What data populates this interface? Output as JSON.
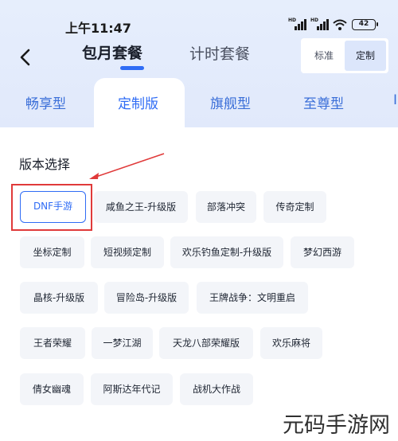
{
  "status_bar": {
    "time": "上午11:47",
    "battery": "42"
  },
  "header": {
    "tabs": [
      {
        "label": "包月套餐",
        "active": true
      },
      {
        "label": "计时套餐",
        "active": false
      }
    ],
    "segmented": [
      {
        "label": "标准",
        "active": false
      },
      {
        "label": "定制",
        "active": true
      }
    ]
  },
  "tiers": [
    {
      "label": "畅享型",
      "active": false
    },
    {
      "label": "定制版",
      "active": true
    },
    {
      "label": "旗舰型",
      "active": false
    },
    {
      "label": "至尊型",
      "active": false
    },
    {
      "label": "I",
      "active": false
    }
  ],
  "section": {
    "title": "版本选择",
    "versions": [
      {
        "label": "DNF手游",
        "selected": true
      },
      {
        "label": "咸鱼之王-升级版"
      },
      {
        "label": "部落冲突"
      },
      {
        "label": "传奇定制"
      },
      {
        "label": "坐标定制"
      },
      {
        "label": "短视频定制"
      },
      {
        "label": "欢乐钓鱼定制-升级版"
      },
      {
        "label": "梦幻西游"
      },
      {
        "label": "晶核-升级版"
      },
      {
        "label": "冒险岛-升级版"
      },
      {
        "label": "王牌战争：文明重启"
      },
      {
        "label": "王者荣耀"
      },
      {
        "label": "一梦江湖"
      },
      {
        "label": "天龙八部荣耀版"
      },
      {
        "label": "欢乐麻将"
      },
      {
        "label": "倩女幽魂"
      },
      {
        "label": "阿斯达年代记"
      },
      {
        "label": "战机大作战"
      }
    ]
  },
  "watermark": "元码手游网",
  "colors": {
    "accent": "#2f6cf5",
    "annotation": "#e03a3a",
    "header_bg": "#e3ebfb"
  }
}
